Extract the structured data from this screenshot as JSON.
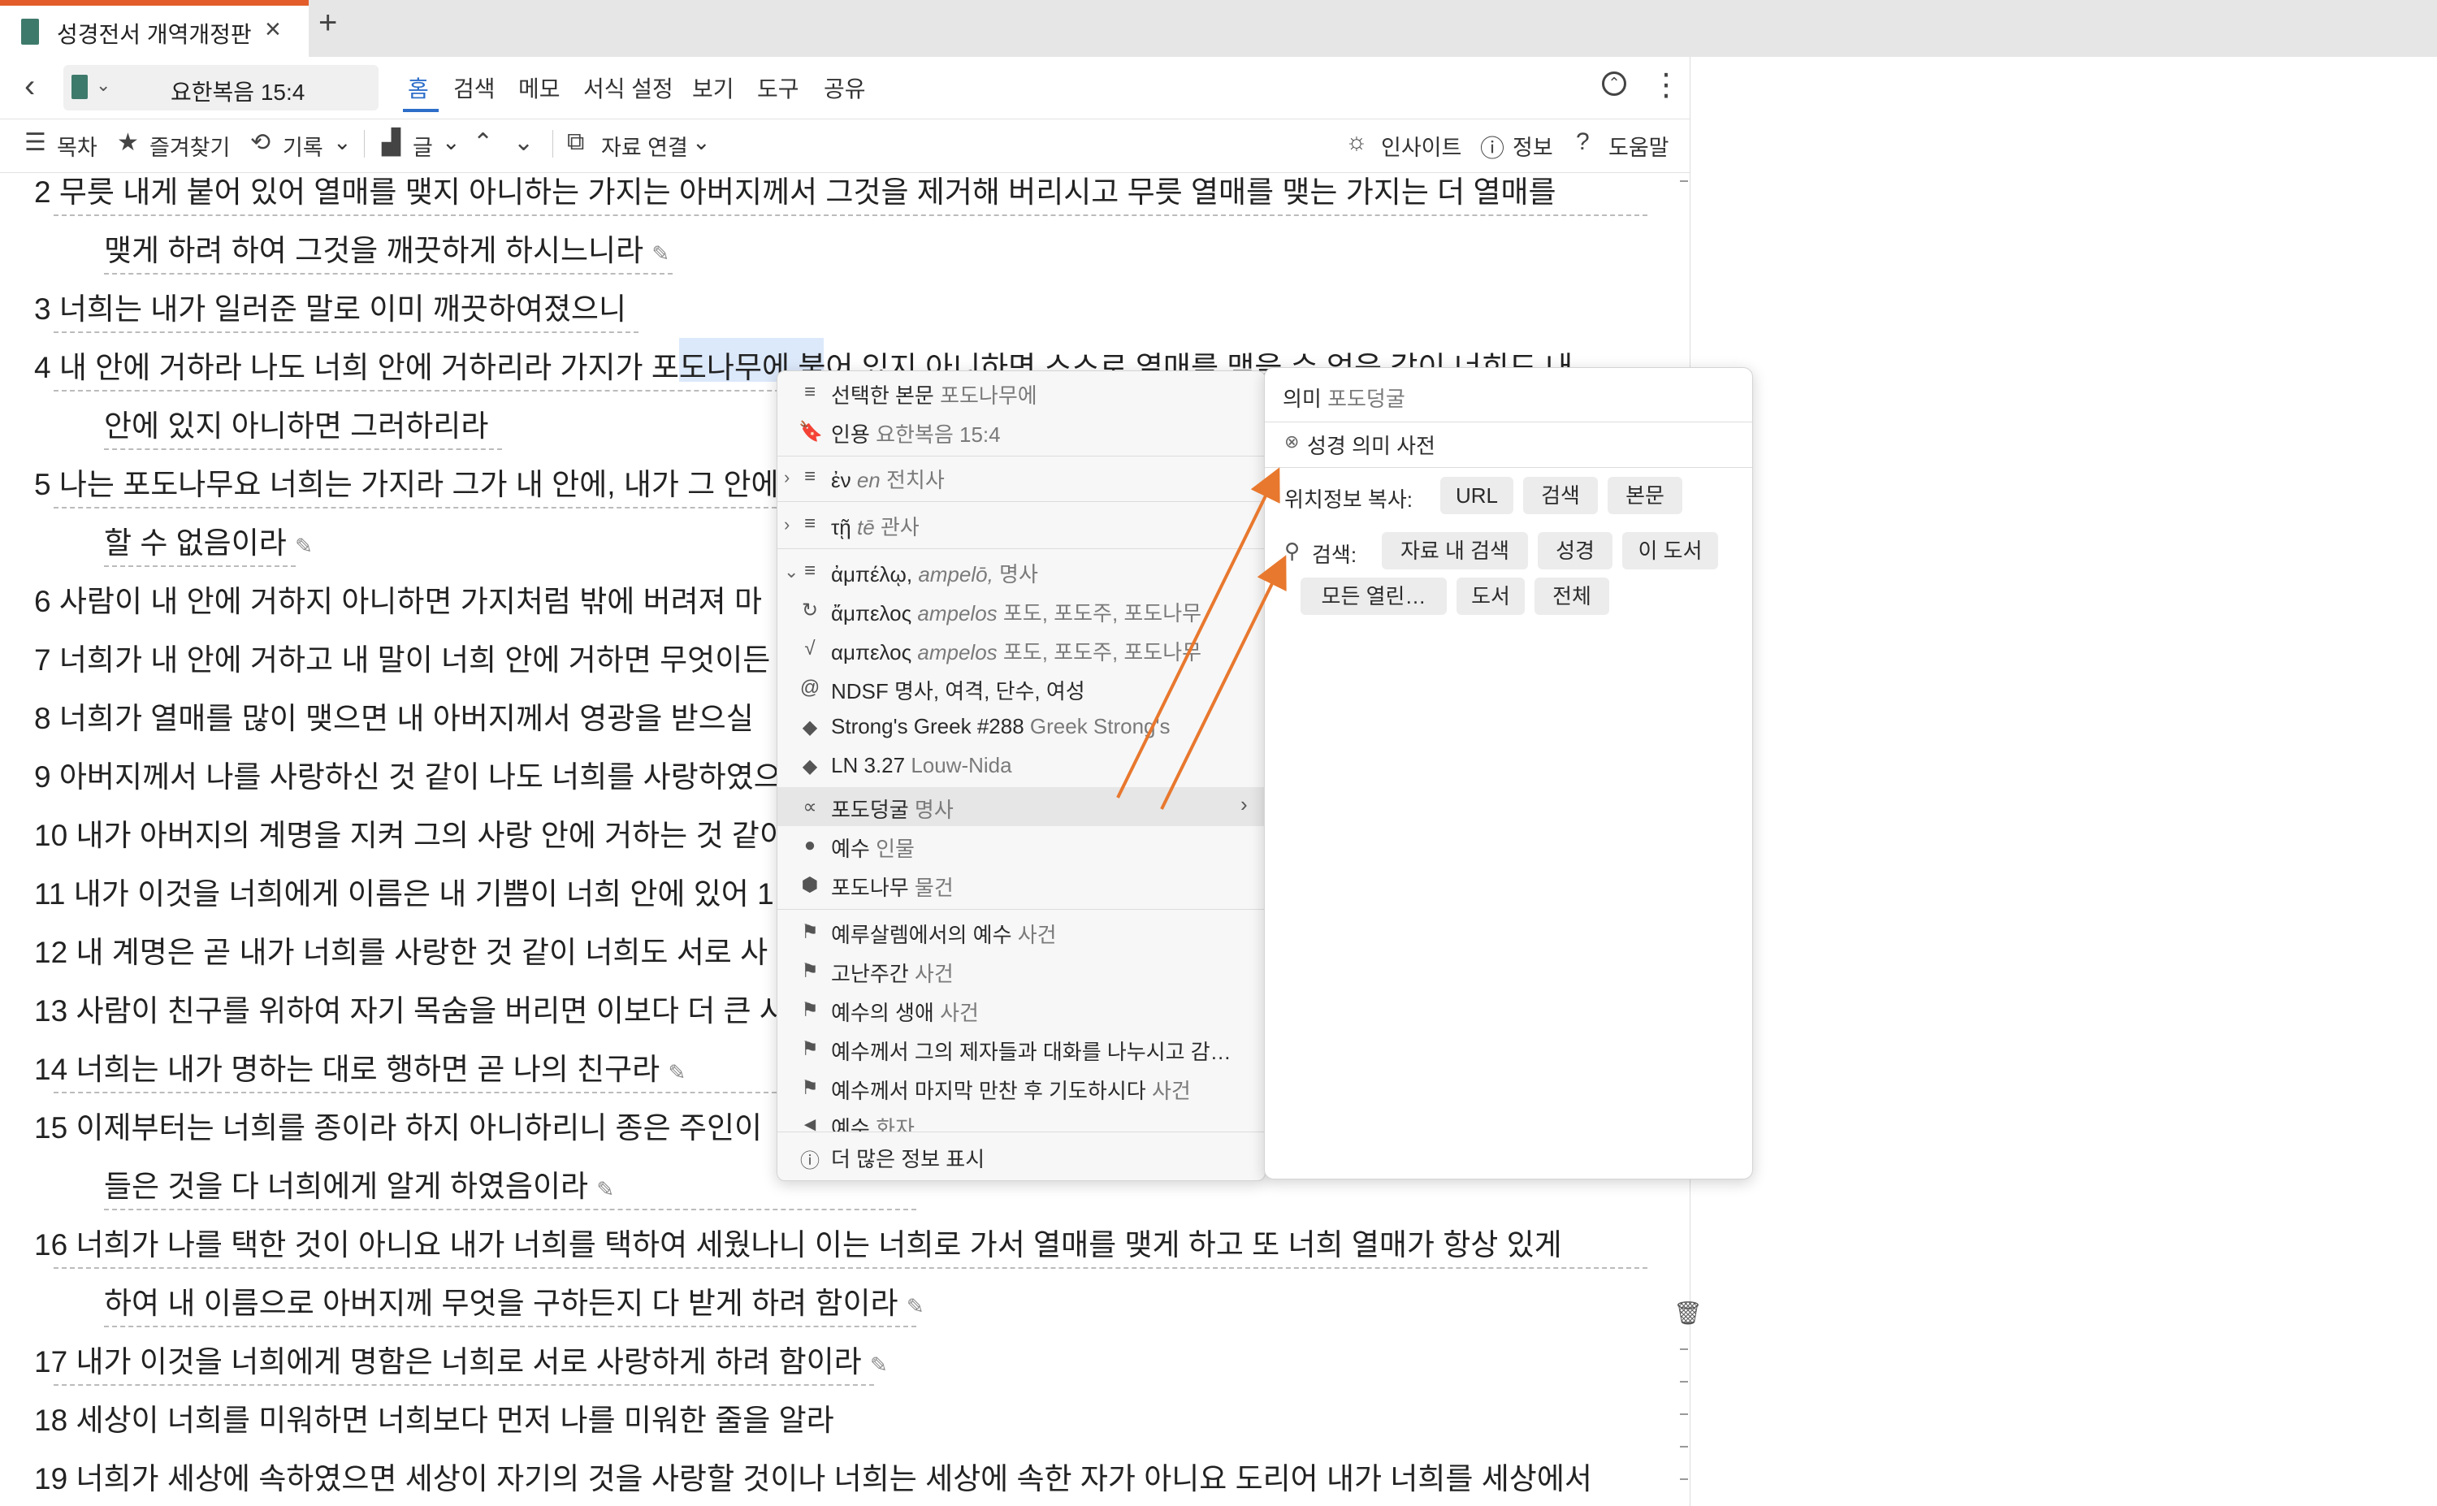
{
  "tab": {
    "title": "성경전서 개역개정판",
    "close": "×",
    "new": "+"
  },
  "toolbar": {
    "reference": "요한복음 15:4",
    "menus": [
      "홈",
      "검색",
      "메모",
      "서식 설정",
      "보기",
      "도구",
      "공유"
    ],
    "row2": {
      "toc": "목차",
      "favorites": "즐겨찾기",
      "history": "기록",
      "text": "글",
      "link": "자료 연결",
      "insight": "인사이트",
      "info": "정보",
      "help": "도움말"
    }
  },
  "verses": [
    {
      "num": "2",
      "text": "무릇 내게 붙어 있어 열매를 맺지 아니하는 가지는 아버지께서 그것을 제거해 버리시고 무릇 열매를 맺는 가지는 더 열매를"
    },
    {
      "num": "",
      "text": "맺게 하려 하여 그것을 깨끗하게 하시느니라"
    },
    {
      "num": "3",
      "text": "너희는 내가 일러준 말로 이미 깨끗하여졌으니"
    },
    {
      "num": "4",
      "text": "내 안에 거하라 나도 너희 안에 거하리라 가지가 포도나무에 붙어 있지 아니하면 스스로 열매를 맺을 수 없음 같이 너희도 내"
    },
    {
      "num": "",
      "text": "안에 있지 아니하면 그러하리라"
    },
    {
      "num": "5",
      "text": "나는 포도나무요 너희는 가지라 그가 내 안에, 내가 그 안에"
    },
    {
      "num": "",
      "text": "할 수 없음이라"
    },
    {
      "num": "6",
      "text": "사람이 내 안에 거하지 아니하면 가지처럼 밖에 버려져 마"
    },
    {
      "num": "7",
      "text": "너희가 내 안에 거하고 내 말이 너희 안에 거하면 무엇이든"
    },
    {
      "num": "8",
      "text": "너희가 열매를 많이 맺으면 내 아버지께서 영광을 받으실"
    },
    {
      "num": "9",
      "text": "아버지께서 나를 사랑하신 것 같이 나도 너희를 사랑하였으"
    },
    {
      "num": "10",
      "text": "내가 아버지의 계명을 지켜 그의 사랑 안에 거하는 것 같이"
    },
    {
      "num": "11",
      "text": "내가 이것을 너희에게 이름은 내 기쁨이 너희 안에 있어 1"
    },
    {
      "num": "12",
      "text": "내 계명은 곧 내가 너희를 사랑한 것 같이 너희도 서로 사"
    },
    {
      "num": "13",
      "text": "사람이 친구를 위하여 자기 목숨을 버리면 이보다 더 큰 사"
    },
    {
      "num": "14",
      "text": "너희는 내가 명하는 대로 행하면 곧 나의 친구라"
    },
    {
      "num": "15",
      "text": "이제부터는 너희를 종이라 하지 아니하리니 종은 주인이"
    },
    {
      "num": "",
      "text": "들은 것을 다 너희에게 알게 하였음이라"
    },
    {
      "num": "16",
      "text": "너희가 나를 택한 것이 아니요 내가 너희를 택하여 세웠나니 이는 너희로 가서 열매를 맺게 하고 또 너희 열매가 항상 있게"
    },
    {
      "num": "",
      "text": "하여 내 이름으로 아버지께 무엇을 구하든지 다 받게 하려 함이라"
    },
    {
      "num": "17",
      "text": "내가 이것을 너희에게 명함은 너희로 서로 사랑하게 하려 함이라"
    },
    {
      "num": "18",
      "text": "세상이 너희를 미워하면 너희보다 먼저 나를 미워한 줄을 알라"
    },
    {
      "num": "19",
      "text": "너희가 세상에 속하였으면 세상이 자기의 것을 사랑할 것이나 너희는 세상에 속한 자가 아니요 도리어 내가 너희를 세상에서"
    }
  ],
  "context_menu": {
    "selected": {
      "label": "선택한 본문",
      "value": "포도나무에"
    },
    "citation": {
      "label": "인용",
      "value": "요한복음 15:4"
    },
    "en": {
      "greek": "ἐν",
      "translit": "en",
      "gloss": "전치사"
    },
    "te": {
      "greek": "τῇ",
      "translit": "tē",
      "gloss": "관사"
    },
    "ampelo": {
      "greek": "ἀμπέλῳ,",
      "translit": "ampelō,",
      "gloss": "명사"
    },
    "ampelos1": {
      "greek": "ἄμπελος",
      "translit": "ampelos",
      "gloss": "포도, 포도주, 포도나무"
    },
    "ampelos2": {
      "greek": "αμπελος",
      "translit": "ampelos",
      "gloss": "포도, 포도주, 포도나무"
    },
    "ndsf": "NDSF 명사, 여격, 단수, 여성",
    "strongs": {
      "label": "Strong's Greek #288",
      "sub": "Greek Strong's"
    },
    "ln": {
      "label": "LN 3.27",
      "sub": "Louw-Nida"
    },
    "grapevine": {
      "label": "포도덩굴",
      "sub": "명사"
    },
    "jesus": {
      "label": "예수",
      "sub": "인물"
    },
    "vine": {
      "label": "포도나무",
      "sub": "물건"
    },
    "events": [
      {
        "label": "예루살렘에서의 예수",
        "sub": "사건"
      },
      {
        "label": "고난주간",
        "sub": "사건"
      },
      {
        "label": "예수의 생애",
        "sub": "사건"
      },
      {
        "label": "예수께서 그의 제자들과 대화를 나누시고 감…",
        "sub": ""
      },
      {
        "label": "예수께서 마지막 만찬 후 기도하시다",
        "sub": "사건"
      },
      {
        "label": "예수",
        "sub": "화자"
      }
    ],
    "more": "더 많은 정보 표시"
  },
  "panel": {
    "meaning_label": "의미",
    "meaning_value": "포도덩굴",
    "dictionary": "성경 의미 사전",
    "copy_label": "위치정보 복사:",
    "copy_buttons": [
      "URL",
      "검색",
      "본문"
    ],
    "search_label": "검색:",
    "search_buttons": [
      "자료 내 검색",
      "성경",
      "이 도서",
      "모든 열린…",
      "도서",
      "전체"
    ]
  },
  "colors": {
    "accent": "#2d6ec9",
    "arrow": "#e8782e",
    "tab_accent": "#e35d2a",
    "highlight": "#dce9fb"
  }
}
